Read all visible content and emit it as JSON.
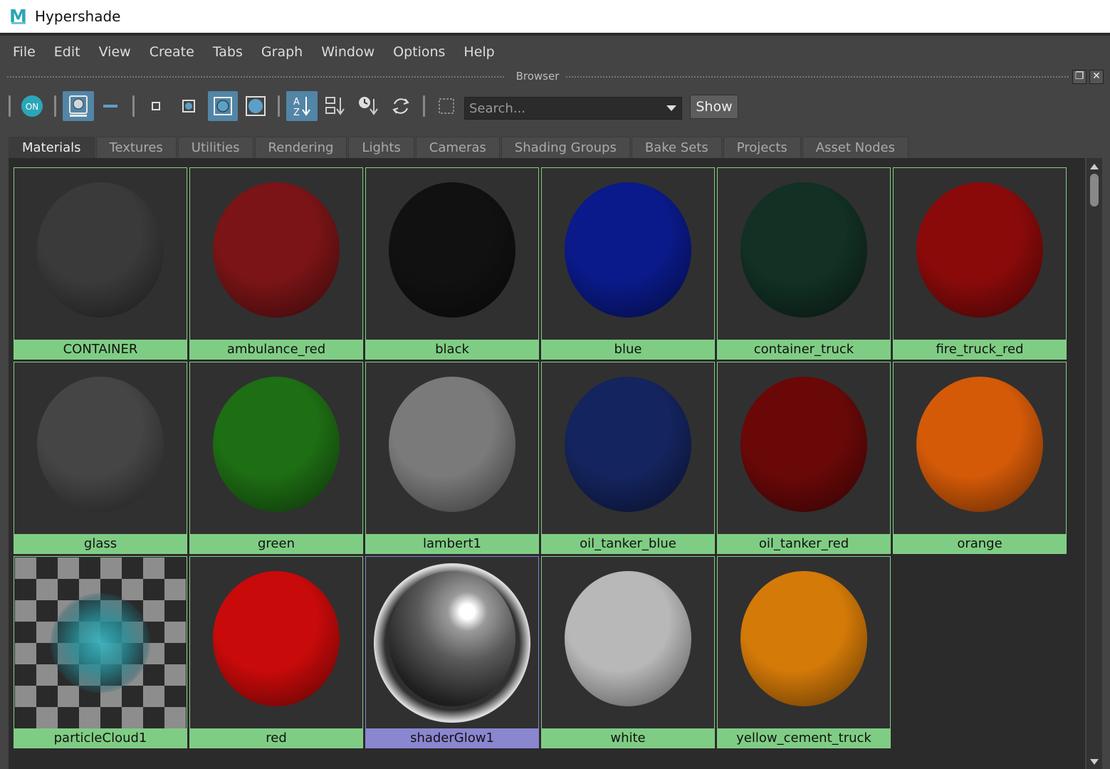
{
  "window": {
    "title": "Hypershade",
    "logo_letter": "M"
  },
  "menu": [
    "File",
    "Edit",
    "View",
    "Create",
    "Tabs",
    "Graph",
    "Window",
    "Options",
    "Help"
  ],
  "panel": {
    "title": "Browser"
  },
  "toolbar": {
    "on_label": "ON",
    "search_placeholder": "Search...",
    "show_label": "Show"
  },
  "tabs": [
    "Materials",
    "Textures",
    "Utilities",
    "Rendering",
    "Lights",
    "Cameras",
    "Shading Groups",
    "Bake Sets",
    "Projects",
    "Asset Nodes"
  ],
  "active_tab": "Materials",
  "materials": [
    {
      "name": "CONTAINER",
      "color": "#3a3a3a"
    },
    {
      "name": "ambulance_red",
      "color": "#7a1416"
    },
    {
      "name": "black",
      "color": "#111111"
    },
    {
      "name": "blue",
      "color": "#0a1a8a"
    },
    {
      "name": "container_truck",
      "color": "#123024"
    },
    {
      "name": "fire_truck_red",
      "color": "#8a0a0a"
    },
    {
      "name": "glass",
      "color": "#454545"
    },
    {
      "name": "green",
      "color": "#1e6e14"
    },
    {
      "name": "lambert1",
      "color": "#7a7a7a"
    },
    {
      "name": "oil_tanker_blue",
      "color": "#14245e"
    },
    {
      "name": "oil_tanker_red",
      "color": "#6a0808"
    },
    {
      "name": "orange",
      "color": "#d45a08"
    },
    {
      "name": "particleCloud1",
      "color": "#2aa0aa"
    },
    {
      "name": "red",
      "color": "#c80a0a"
    },
    {
      "name": "shaderGlow1",
      "color": "#888888"
    },
    {
      "name": "white",
      "color": "#b8b8b8"
    },
    {
      "name": "yellow_cement_truck",
      "color": "#d47a08"
    }
  ],
  "selected_material": "shaderGlow1"
}
